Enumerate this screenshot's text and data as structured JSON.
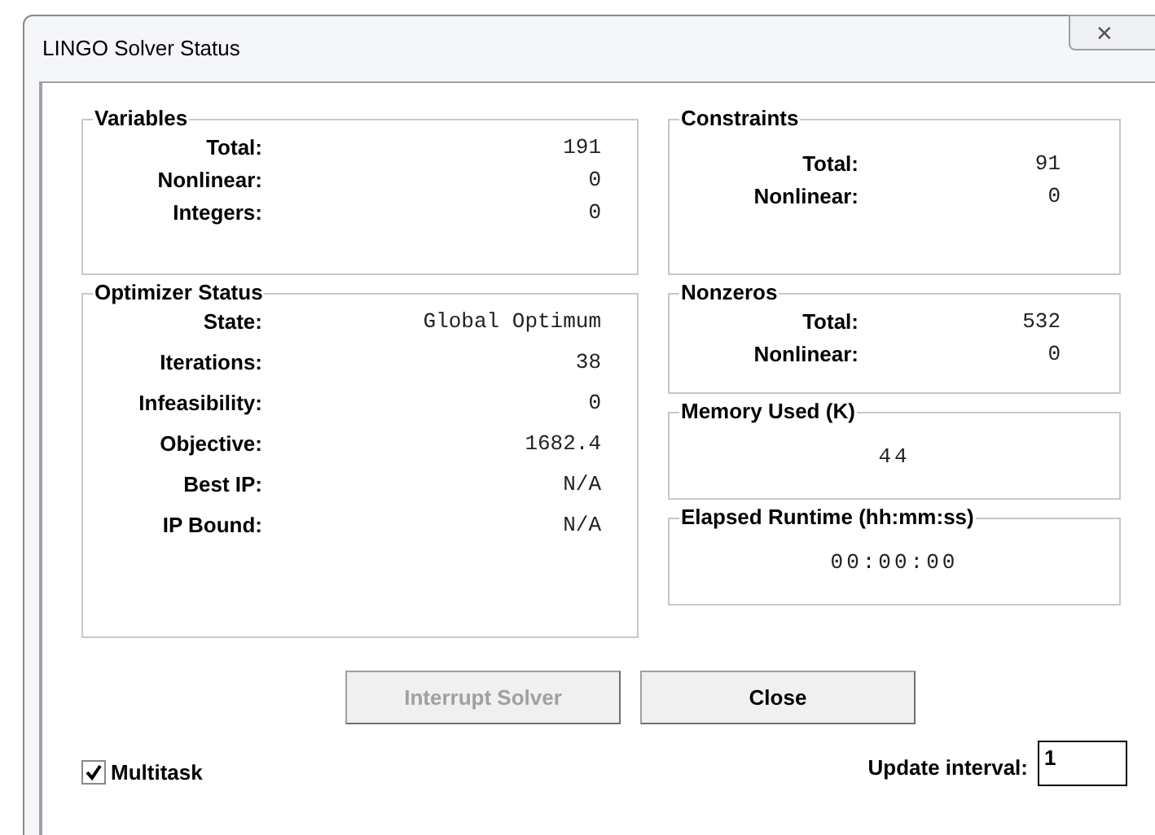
{
  "window": {
    "title": "LINGO Solver Status",
    "close": "✕"
  },
  "left_groups": [
    {
      "title": "Variables",
      "rows": [
        {
          "label": "Total:",
          "value": "191"
        },
        {
          "label": "Nonlinear:",
          "value": "0"
        },
        {
          "label": "Integers:",
          "value": "0"
        }
      ]
    },
    {
      "title": "Optimizer Status",
      "rows": [
        {
          "label": "State:",
          "value": "Global Optimum"
        },
        {
          "label": "Iterations:",
          "value": "38"
        },
        {
          "label": "Infeasibility:",
          "value": "0"
        },
        {
          "label": "Objective:",
          "value": "1682.4"
        },
        {
          "label": "Best IP:",
          "value": "N/A"
        },
        {
          "label": "IP Bound:",
          "value": "N/A"
        }
      ]
    }
  ],
  "right_groups": [
    {
      "title": "Constraints",
      "rows": [
        {
          "label": "Total:",
          "value": "91"
        },
        {
          "label": "Nonlinear:",
          "value": "0"
        }
      ]
    },
    {
      "title": "Nonzeros",
      "rows": [
        {
          "label": "Total:",
          "value": "532"
        },
        {
          "label": "Nonlinear:",
          "value": "0"
        }
      ]
    },
    {
      "title": "Memory Used (K)",
      "rows": [
        {
          "value": "44"
        }
      ]
    },
    {
      "title": "Elapsed Runtime (hh:mm:ss)",
      "rows": [
        {
          "value": "00:00:00"
        }
      ]
    }
  ],
  "buttons": [
    {
      "label": "Interrupt Solver",
      "disabled": true
    },
    {
      "label": "Close",
      "disabled": false
    }
  ],
  "multitask": {
    "label": "Multitask",
    "checked": true
  },
  "update_interval": {
    "label": "Update interval:",
    "value": "1"
  }
}
